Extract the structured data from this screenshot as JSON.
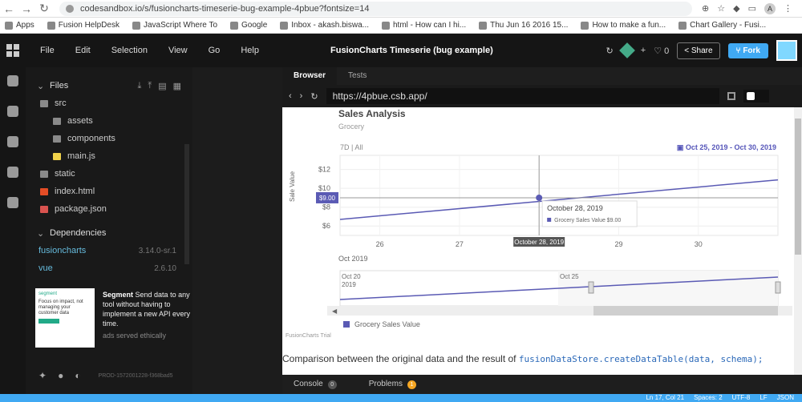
{
  "browser": {
    "url": "codesandbox.io/s/fusioncharts-timeserie-bug-example-4pbue?fontsize=14",
    "profile_initial": "A"
  },
  "bookmarks": [
    {
      "label": "Apps"
    },
    {
      "label": "Fusion HelpDesk"
    },
    {
      "label": "JavaScript Where To"
    },
    {
      "label": "Google"
    },
    {
      "label": "Inbox - akash.biswa..."
    },
    {
      "label": "html - How can I hi..."
    },
    {
      "label": "Thu Jun 16 2016 15..."
    },
    {
      "label": "How to make a fun..."
    },
    {
      "label": "Chart Gallery - Fusi..."
    }
  ],
  "topbar": {
    "menu": [
      "File",
      "Edit",
      "Selection",
      "View",
      "Go",
      "Help"
    ],
    "title": "FusionCharts Timeserie (bug example)",
    "likes": "0",
    "share_label": "Share",
    "fork_label": "Fork"
  },
  "sidebar": {
    "files_label": "Files",
    "files": [
      {
        "name": "src",
        "indent": 0,
        "kind": "folder"
      },
      {
        "name": "assets",
        "indent": 1,
        "kind": "folder"
      },
      {
        "name": "components",
        "indent": 1,
        "kind": "folder"
      },
      {
        "name": "main.js",
        "indent": 1,
        "kind": "js"
      },
      {
        "name": "static",
        "indent": 0,
        "kind": "folder"
      },
      {
        "name": "index.html",
        "indent": 0,
        "kind": "html"
      },
      {
        "name": "package.json",
        "indent": 0,
        "kind": "json"
      }
    ],
    "deps_label": "Dependencies",
    "dependencies": [
      {
        "name": "fusioncharts",
        "version": "3.14.0-sr.1"
      },
      {
        "name": "vue",
        "version": "2.6.10"
      }
    ],
    "ad": {
      "brand": "Segment",
      "text": "Send data to any tool without having to implement a new API every time.",
      "note": "ads served ethically",
      "image_brand": "segment",
      "image_text": "Focus on impact, not managing your customer data"
    },
    "prod_id": "PROD-1572001228-f368bad5"
  },
  "preview": {
    "tabs": [
      "Browser",
      "Tests"
    ],
    "url": "https://4pbue.csb.app/",
    "description": "Comparison between the original data and the result of",
    "code": "fusionDataStore.createDataTable(data, schema);",
    "trial_label": "FusionCharts Trial"
  },
  "chart_data": {
    "type": "line",
    "title": "Sales Analysis",
    "subtitle": "Grocery",
    "ylabel": "Sale Value",
    "range_buttons": [
      "7D",
      "All"
    ],
    "date_range": "Oct 25, 2019 - Oct 30, 2019",
    "x_ticks": [
      "26",
      "27",
      "28",
      "29",
      "30"
    ],
    "x_month": "Oct 2019",
    "y_ticks": [
      "$12",
      "$10",
      "$8",
      "$6"
    ],
    "series": [
      {
        "name": "Grocery Sales Value",
        "color": "#5a5ab4",
        "x": [
          "25.5",
          "31"
        ],
        "y": [
          6.7,
          10.9
        ]
      }
    ],
    "crosshair": {
      "date": "October 28, 2019",
      "value": "$9.00",
      "tooltip_series": "Grocery Sales Value"
    },
    "navigator": {
      "labels": [
        "Oct 20",
        "2019",
        "Oct 25"
      ]
    },
    "grid": true,
    "legend": "bottom-left"
  },
  "console": {
    "console_label": "Console",
    "console_count": "0",
    "problems_label": "Problems",
    "problems_count": "1"
  },
  "status": [
    "Ln 17, Col 21",
    "Spaces: 2",
    "UTF-8",
    "LF",
    "JSON"
  ]
}
